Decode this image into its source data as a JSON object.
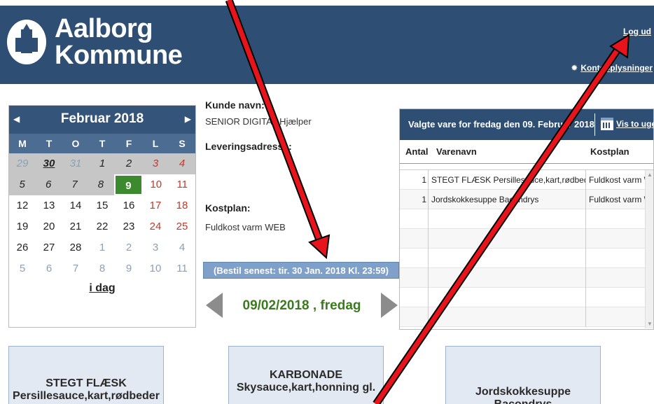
{
  "header": {
    "logo_text_line1": "Aalborg",
    "logo_text_line2": "Kommune",
    "logout": "Log ud",
    "konto": "Kontooplysninger",
    "bg_color": "#2e4e73"
  },
  "calendar": {
    "prev_icon": "chevron-left-icon",
    "next_icon": "chevron-right-icon",
    "title": "Februar 2018",
    "weekdays": [
      "M",
      "T",
      "O",
      "T",
      "F",
      "L",
      "S"
    ],
    "rows": [
      [
        "29",
        "30",
        "31",
        "1",
        "2",
        "3",
        "4"
      ],
      [
        "5",
        "6",
        "7",
        "8",
        "9",
        "10",
        "11"
      ],
      [
        "12",
        "13",
        "14",
        "15",
        "16",
        "17",
        "18"
      ],
      [
        "19",
        "20",
        "21",
        "22",
        "23",
        "24",
        "25"
      ],
      [
        "26",
        "27",
        "28",
        "1",
        "2",
        "3",
        "4"
      ],
      [
        "5",
        "6",
        "7",
        "8",
        "9",
        "10",
        "11"
      ]
    ],
    "selected": "9",
    "today_link": "i dag"
  },
  "customer": {
    "name_label": "Kunde navn:",
    "name_value": "SENIOR DIGITAL Hjælper",
    "address_label": "Leveringsadresse:",
    "plan_label": "Kostplan:",
    "plan_value": "Fuldkost varm WEB",
    "deadline": "(Bestil senest: tir. 30 Jan. 2018 Kl. 23:59)",
    "date": "09/02/2018 , fredag"
  },
  "panel": {
    "title": "Valgte vare for fredag den 09. Februar 2018",
    "vis_button": "Vis to uger",
    "columns": [
      "Antal",
      "Varenavn",
      "Kostplan"
    ],
    "rows": [
      {
        "antal": "1",
        "vare": "STEGT FLÆSK Persillesauce,kart,rødbeder",
        "kost": "Fuldkost varm WEB"
      },
      {
        "antal": "1",
        "vare": "Jordskokkesuppe Bacondrys",
        "kost": "Fuldkost varm WEB"
      }
    ],
    "empty_rows": 6
  },
  "cards": [
    {
      "line1": "STEGT FLÆSK",
      "line2": "Persillesauce,kart,rødbeder"
    },
    {
      "line1": "KARBONADE",
      "line2": "Skysauce,kart,honning gl."
    },
    {
      "line1": "Jordskokkesuppe Bacondrys",
      "line2": ""
    }
  ],
  "annotation_color": "#e8141c"
}
